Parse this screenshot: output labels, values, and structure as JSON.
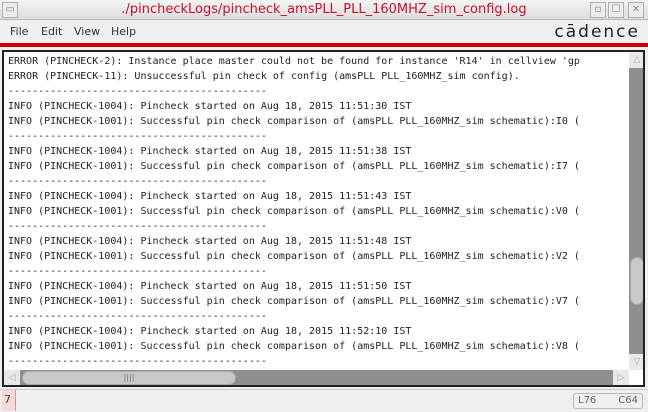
{
  "window": {
    "title": "./pincheckLogs/pincheck_amsPLL_PLL_160MHZ_sim_config.log"
  },
  "menu": [
    "File",
    "Edit",
    "View",
    "Help"
  ],
  "brand": {
    "logo": "cādence",
    "accent": "#cc0000"
  },
  "log_lines": [
    "ERROR (PINCHECK-2): Instance place master could not be found for instance 'R14' in cellview 'gp",
    "ERROR (PINCHECK-11): Unsuccessful pin check of config (amsPLL PLL_160MHZ_sim config).",
    "-------------------------------------------",
    "INFO (PINCHECK-1004): Pincheck started on Aug 18, 2015 11:51:30 IST",
    "INFO (PINCHECK-1001): Successful pin check comparison of (amsPLL PLL_160MHZ_sim schematic):I0 (",
    "-------------------------------------------",
    "INFO (PINCHECK-1004): Pincheck started on Aug 18, 2015 11:51:38 IST",
    "INFO (PINCHECK-1001): Successful pin check comparison of (amsPLL PLL_160MHZ_sim schematic):I7 (",
    "-------------------------------------------",
    "INFO (PINCHECK-1004): Pincheck started on Aug 18, 2015 11:51:43 IST",
    "INFO (PINCHECK-1001): Successful pin check comparison of (amsPLL PLL_160MHZ_sim schematic):V0 (",
    "-------------------------------------------",
    "INFO (PINCHECK-1004): Pincheck started on Aug 18, 2015 11:51:48 IST",
    "INFO (PINCHECK-1001): Successful pin check comparison of (amsPLL PLL_160MHZ_sim schematic):V2 (",
    "-------------------------------------------",
    "INFO (PINCHECK-1004): Pincheck started on Aug 18, 2015 11:51:50 IST",
    "INFO (PINCHECK-1001): Successful pin check comparison of (amsPLL PLL_160MHZ_sim schematic):V7 (",
    "-------------------------------------------",
    "INFO (PINCHECK-1004): Pincheck started on Aug 18, 2015 11:52:10 IST",
    "INFO (PINCHECK-1001): Successful pin check comparison of (amsPLL PLL_160MHZ_sim schematic):V8 (",
    "-------------------------------------------"
  ],
  "status": {
    "count": "7",
    "line": "L76",
    "column": "C64"
  }
}
